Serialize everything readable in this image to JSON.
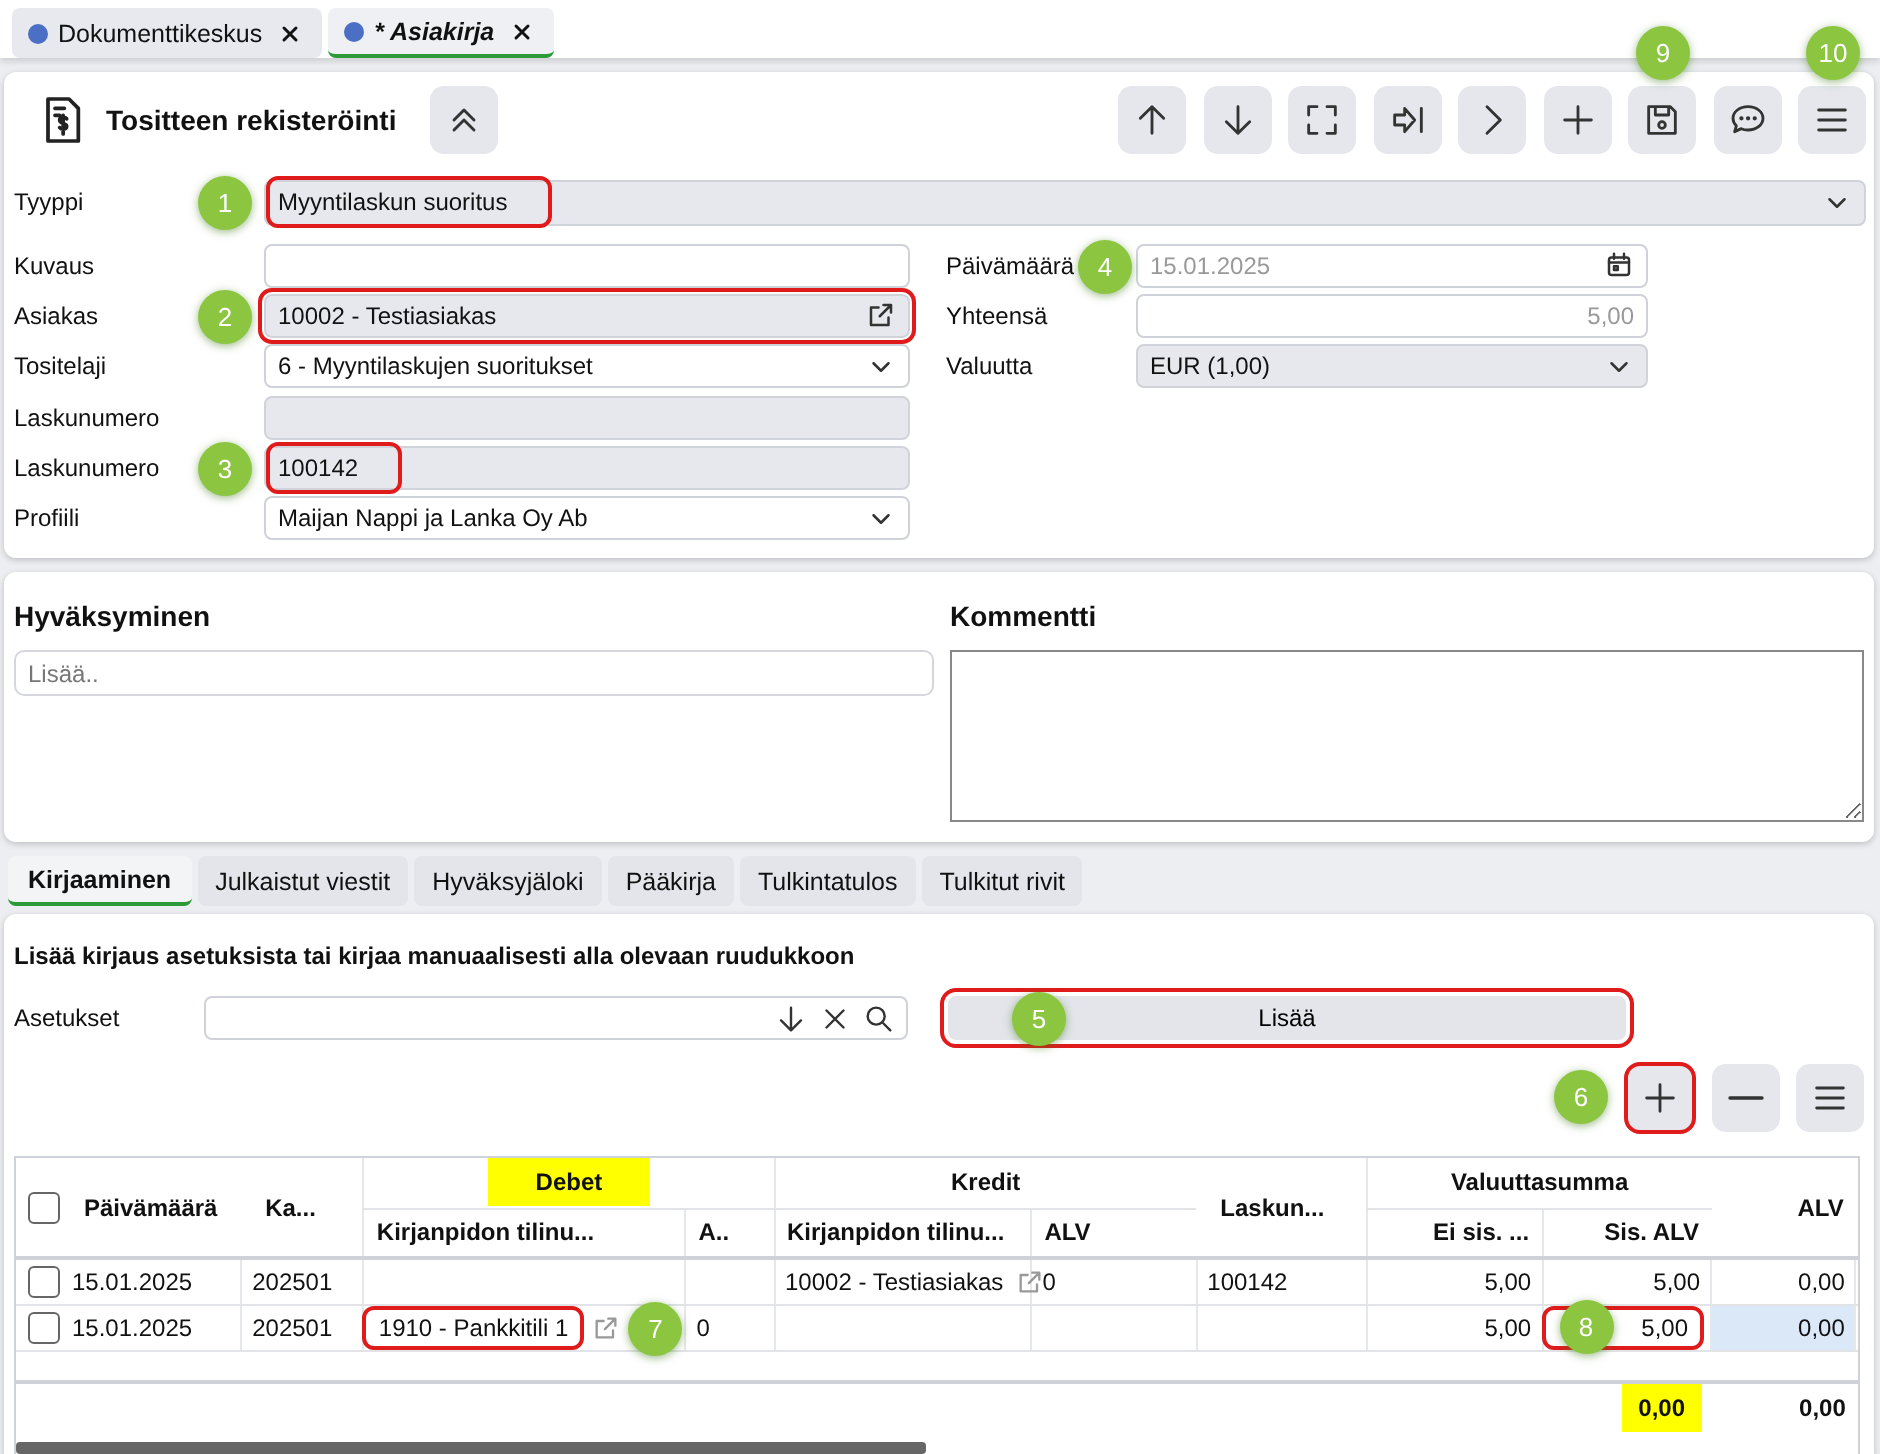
{
  "doc_tabs": [
    {
      "label": "Dokumenttikeskus",
      "selected": false
    },
    {
      "label": "* Asiakirja",
      "selected": true
    }
  ],
  "header": {
    "title": "Tositteen rekisteröinti"
  },
  "toolbar": [
    {
      "kind": "up"
    },
    {
      "kind": "down"
    },
    {
      "kind": "fullscreen"
    },
    {
      "kind": "skip"
    },
    {
      "kind": "next"
    },
    {
      "kind": "add"
    },
    {
      "kind": "save",
      "marker": "9"
    },
    {
      "kind": "comment"
    },
    {
      "kind": "menu",
      "marker": "10"
    }
  ],
  "type_field": {
    "label": "Tyyppi",
    "kind": "select",
    "readonly": true,
    "value": "Myyntilaskun suoritus",
    "marker": "1",
    "highlighted": true
  },
  "left_fields": [
    {
      "label": "Kuvaus",
      "kind": "text",
      "readonly": false,
      "highlighted": false
    },
    {
      "label": "Asiakas",
      "kind": "link",
      "readonly": true,
      "value": "10002 - Testiasiakas",
      "marker": "2",
      "highlighted": true
    },
    {
      "label": "Tositelaji",
      "kind": "select",
      "readonly": false,
      "value": "6 - Myyntilaskujen suoritukset",
      "highlighted": false
    },
    {
      "label": "Laskunumero",
      "kind": "text",
      "readonly": true,
      "highlighted": false
    },
    {
      "label": "Laskunumero",
      "kind": "text",
      "readonly": true,
      "value": "100142",
      "marker": "3",
      "highlighted": true
    },
    {
      "label": "Profiili",
      "kind": "select",
      "readonly": false,
      "value": "Maijan Nappi ja Lanka Oy Ab",
      "highlighted": false
    }
  ],
  "right_fields": [
    {
      "label": "Päivämäärä",
      "kind": "date",
      "readonly": false,
      "disabled": true,
      "value": "15.01.2025",
      "marker": "4",
      "highlighted": false
    },
    {
      "label": "Yhteensä",
      "kind": "number",
      "readonly": false,
      "disabled": true,
      "value": "5,00",
      "highlighted": false
    },
    {
      "label": "Valuutta",
      "kind": "select",
      "readonly": true,
      "disabled": false,
      "value": "EUR (1,00)",
      "highlighted": false
    }
  ],
  "approval": {
    "title": "Hyväksyminen",
    "placeholder": "Lisää.."
  },
  "comment": {
    "title": "Kommentti"
  },
  "section_tabs": [
    {
      "label": "Kirjaaminen",
      "selected": true
    },
    {
      "label": "Julkaistut viestit",
      "selected": false
    },
    {
      "label": "Hyväksyjäloki",
      "selected": false
    },
    {
      "label": "Pääkirja",
      "selected": false
    },
    {
      "label": "Tulkintatulos",
      "selected": false
    },
    {
      "label": "Tulkitut rivit",
      "selected": false
    }
  ],
  "instruction": "Lisää kirjaus asetuksista tai kirjaa manuaalisesti alla olevaan ruudukkoon",
  "settings": {
    "label": "Asetukset"
  },
  "add_button": {
    "label": "Lisää",
    "marker": "5",
    "highlighted": true
  },
  "grid_buttons": [
    {
      "kind": "add",
      "marker": "6",
      "highlighted": true
    },
    {
      "kind": "remove",
      "highlighted": false
    },
    {
      "kind": "menu",
      "highlighted": false
    }
  ],
  "table": {
    "header_checked": false,
    "columns": [
      {
        "label": "Päivämäärä",
        "kind": "text"
      },
      {
        "label": "Ka...",
        "kind": "text"
      },
      {
        "label": "Kirjanpidon tilinu...",
        "kind": "text"
      },
      {
        "label": "A..",
        "kind": "text"
      },
      {
        "label": "Kirjanpidon tilinu...",
        "kind": "text"
      },
      {
        "label": "ALV",
        "kind": "text"
      },
      {
        "label": "Laskun...",
        "kind": "text"
      },
      {
        "label": "Ei sis. ...",
        "kind": "number"
      },
      {
        "label": "Sis. ALV",
        "kind": "number"
      },
      {
        "label": "ALV",
        "kind": "number"
      }
    ],
    "column_groups": [
      {
        "label": "Debet",
        "marked": true
      },
      {
        "label": "Kredit",
        "marked": false
      },
      {
        "label": "Valuuttasumma",
        "marked": false
      }
    ],
    "rows": [
      {
        "checked": false,
        "cells": [
          "15.01.2025",
          "202501",
          null,
          null,
          {
            "text": "10002 - Testiasiakas",
            "link": true
          },
          "0",
          "100142",
          "5,00",
          "5,00",
          "0,00"
        ]
      },
      {
        "checked": false,
        "cells": [
          "15.01.2025",
          "202501",
          {
            "text": "1910 - Pankkitili 1",
            "link": true,
            "highlighted": true,
            "marker": "7"
          },
          "0",
          null,
          null,
          null,
          "5,00",
          {
            "text": "5,00",
            "highlighted": true,
            "marker": "8"
          },
          {
            "text": "0,00",
            "focused": true
          }
        ]
      }
    ],
    "totals": [
      {
        "text": "0,00",
        "marked": true
      },
      {
        "text": "0,00",
        "marked": false
      }
    ]
  }
}
